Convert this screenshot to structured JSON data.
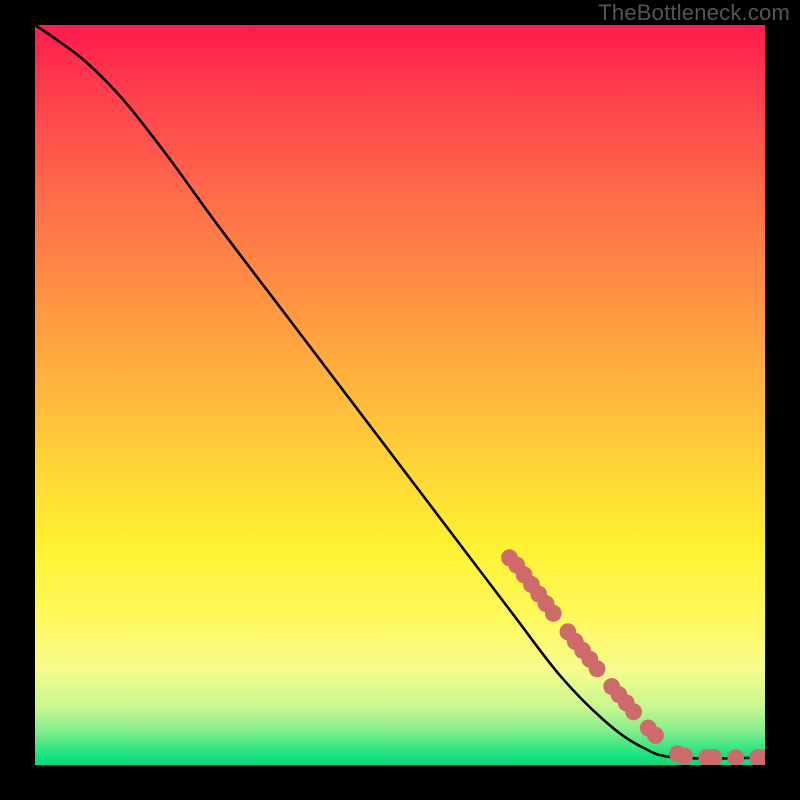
{
  "watermark": "TheBottleneck.com",
  "chart_data": {
    "type": "line",
    "title": "",
    "xlabel": "",
    "ylabel": "",
    "xlim": [
      0,
      100
    ],
    "ylim": [
      0,
      100
    ],
    "curve": [
      {
        "x": 0,
        "y": 100
      },
      {
        "x": 3,
        "y": 98
      },
      {
        "x": 7,
        "y": 95
      },
      {
        "x": 12,
        "y": 90
      },
      {
        "x": 18,
        "y": 82.5
      },
      {
        "x": 25,
        "y": 73
      },
      {
        "x": 35,
        "y": 60
      },
      {
        "x": 45,
        "y": 47
      },
      {
        "x": 55,
        "y": 34
      },
      {
        "x": 65,
        "y": 21
      },
      {
        "x": 72,
        "y": 12
      },
      {
        "x": 78,
        "y": 6
      },
      {
        "x": 83,
        "y": 2.5
      },
      {
        "x": 88,
        "y": 1
      },
      {
        "x": 100,
        "y": 1
      }
    ],
    "highlight_points": [
      {
        "x": 65,
        "y": 28
      },
      {
        "x": 66,
        "y": 27
      },
      {
        "x": 67,
        "y": 25.7
      },
      {
        "x": 68,
        "y": 24.4
      },
      {
        "x": 69,
        "y": 23.1
      },
      {
        "x": 70,
        "y": 21.8
      },
      {
        "x": 71,
        "y": 20.5
      },
      {
        "x": 73,
        "y": 18
      },
      {
        "x": 74,
        "y": 16.7
      },
      {
        "x": 75,
        "y": 15.5
      },
      {
        "x": 76,
        "y": 14.3
      },
      {
        "x": 77,
        "y": 13.0
      },
      {
        "x": 79,
        "y": 10.6
      },
      {
        "x": 80,
        "y": 9.5
      },
      {
        "x": 81,
        "y": 8.4
      },
      {
        "x": 82,
        "y": 7.2
      },
      {
        "x": 84,
        "y": 5.0
      },
      {
        "x": 85,
        "y": 4.0
      },
      {
        "x": 88,
        "y": 1.5
      },
      {
        "x": 89,
        "y": 1.2
      },
      {
        "x": 92,
        "y": 1
      },
      {
        "x": 93,
        "y": 1
      },
      {
        "x": 96,
        "y": 1
      },
      {
        "x": 99,
        "y": 1
      },
      {
        "x": 100,
        "y": 1
      }
    ],
    "highlight_color": "#cf6a6a",
    "curve_color": "#000000"
  }
}
